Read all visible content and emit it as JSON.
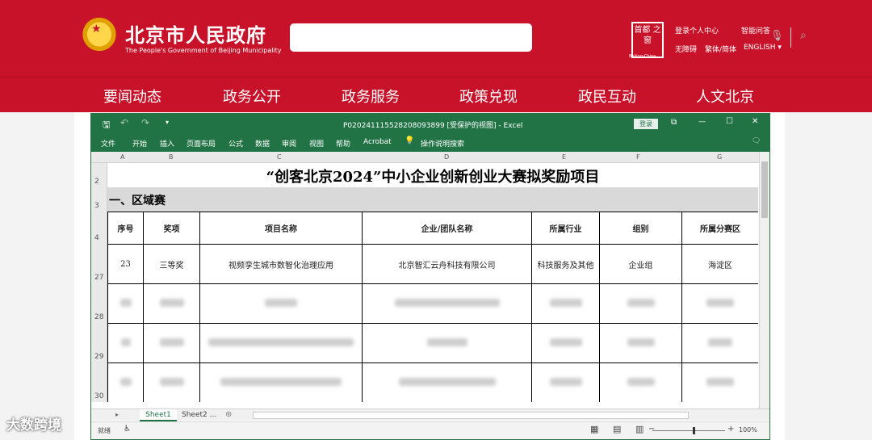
{
  "header": {
    "site_title": "北京市人民政府",
    "site_subtitle": "The People's Government of Beijing Municipality",
    "emblem_star": "★",
    "seal_text": "首都 之窗",
    "seal_sub": "Beijing-China",
    "links": {
      "personal_center": "登录个人中心",
      "smart_qa": "智能问答",
      "accessibility": "无障碍",
      "simp_trad": "繁体/简体",
      "english": "ENGLISH ▾"
    },
    "mic_icon": "🎙",
    "search_icon": "⌕"
  },
  "nav": [
    "要闻动态",
    "政务公开",
    "政务服务",
    "政策兑现",
    "政民互动",
    "人文北京"
  ],
  "excel": {
    "filename": "P020241115528208093899 [受保护的视图] - Excel",
    "login": "登录",
    "qa": {
      "save": "🖫",
      "undo": "↶",
      "redo": "↷",
      "more": "▾"
    },
    "window": {
      "restore": "⧉",
      "min": "—",
      "max": "☐",
      "close": "✕"
    },
    "ribbon_tabs": [
      "文件",
      "开始",
      "插入",
      "页面布局",
      "公式",
      "数据",
      "审阅",
      "视图",
      "帮助",
      "Acrobat"
    ],
    "tell_me_icon": "💡",
    "tell_me": "操作说明搜索",
    "comment_icon": "🗨",
    "columns": [
      "A",
      "B",
      "C",
      "D",
      "E",
      "F",
      "G"
    ],
    "rows": [
      "2",
      "3",
      "4",
      "27",
      "28",
      "29",
      "30"
    ],
    "sheet_title": "“创客北京2024”中小企业创新创业大赛拟奖励项目",
    "section": "一、区域赛",
    "headers": [
      "序号",
      "奖项",
      "项目名称",
      "企业/团队名称",
      "所属行业",
      "组别",
      "所属分赛区"
    ],
    "row1": [
      "23",
      "三等奖",
      "视频孪生城市数智化治理应用",
      "北京智汇云舟科技有限公司",
      "科技服务及其他",
      "企业组",
      "海淀区"
    ],
    "sheets": [
      "Sheet1",
      "Sheet2 ..."
    ],
    "status_mode": "就绪",
    "status_icon": "♿",
    "zoom_minus": "−",
    "zoom_plus": "+",
    "zoom": "100%"
  },
  "watermark": "大数跨境"
}
